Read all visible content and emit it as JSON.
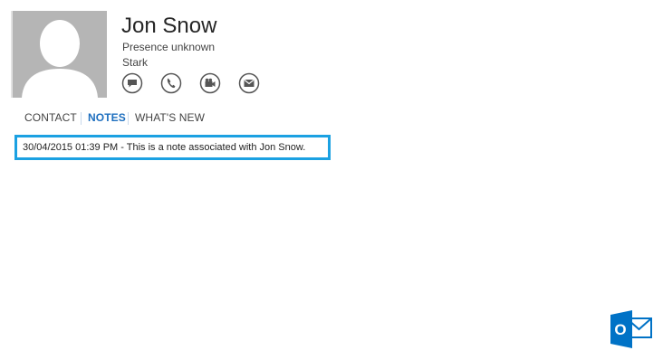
{
  "contact": {
    "name": "Jon Snow",
    "presence": "Presence unknown",
    "company": "Stark"
  },
  "actions": [
    {
      "name": "chat",
      "icon": "chat-icon"
    },
    {
      "name": "call",
      "icon": "phone-icon"
    },
    {
      "name": "video",
      "icon": "video-call-icon"
    },
    {
      "name": "email",
      "icon": "mail-icon"
    }
  ],
  "tabs": [
    {
      "label": "CONTACT",
      "active": false
    },
    {
      "label": "NOTES",
      "active": true
    },
    {
      "label": "WHAT'S NEW",
      "active": false
    }
  ],
  "note": {
    "text": "30/04/2015 01:39 PM - This is a note associated with Jon Snow."
  },
  "branding": {
    "logo_icon": "outlook-icon",
    "logo_letter": "O"
  },
  "colors": {
    "accent": "#1e6fbf",
    "highlight_border": "#1ba1e2",
    "outlook_blue": "#0072c6",
    "avatar_bg": "#b5b5b5"
  }
}
